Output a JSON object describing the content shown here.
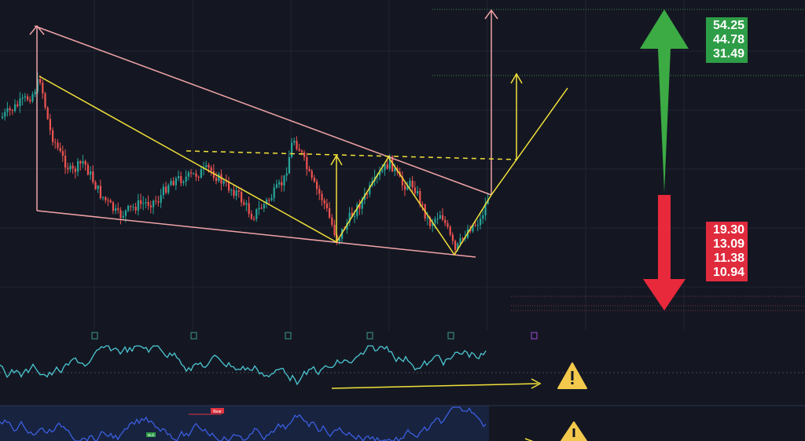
{
  "chart_data": [
    {
      "type": "candlestick",
      "title": "",
      "annotations": {
        "pattern": "falling-wedge",
        "target_labels_green": [
          "54.25",
          "44.78",
          "31.49"
        ],
        "target_labels_red": [
          "19.30",
          "13.09",
          "11.38",
          "10.94"
        ],
        "arrow_up_color": "#3cab44",
        "arrow_down_color": "#e8293c",
        "wedge_color": "#f0a3a6",
        "pattern_color": "#f2e13a",
        "event_markers": [
          "E",
          "E",
          "E",
          "E",
          "E",
          "E"
        ]
      }
    },
    {
      "type": "line",
      "series": [
        {
          "color": "#4cc7d3"
        }
      ],
      "annotations": {
        "divergence_arrow_color": "#f2e13a",
        "warning_icon": "warning-icon"
      }
    },
    {
      "type": "line",
      "series": [
        {
          "color": "#3b5fe0"
        }
      ],
      "annotations": {
        "labels": [
          "Bear",
          "Bull"
        ],
        "warning_icon": "warning-icon"
      }
    }
  ],
  "colors": {
    "up": "#26a69a",
    "down": "#ef5350",
    "background": "#141722",
    "grid": "#222633"
  }
}
